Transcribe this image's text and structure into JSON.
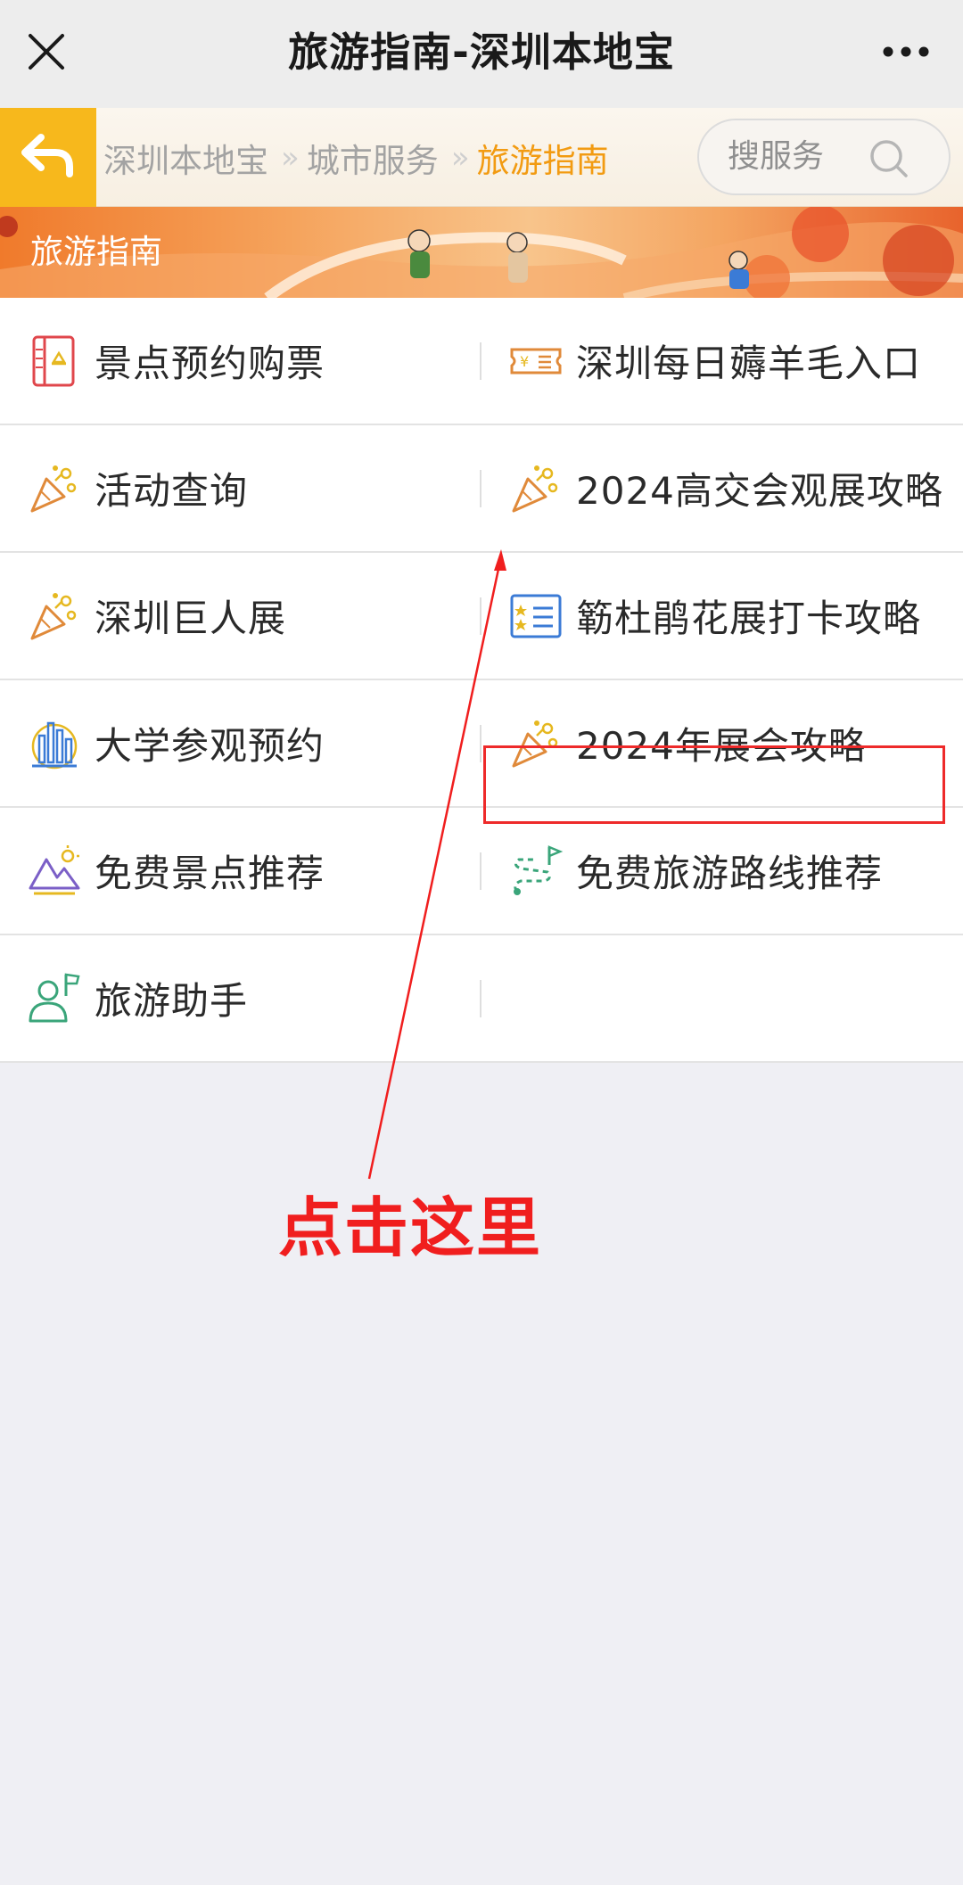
{
  "topbar": {
    "title": "旅游指南-深圳本地宝",
    "close_icon": "close-icon",
    "more_icon": "more-dots-icon"
  },
  "breadcrumb": {
    "back_icon": "back-arrow-icon",
    "items": [
      "深圳本地宝",
      "城市服务",
      "旅游指南"
    ],
    "separator": "»",
    "active_color": "#f29b12"
  },
  "search": {
    "placeholder": "搜服务",
    "icon": "search-icon"
  },
  "banner": {
    "title": "旅游指南"
  },
  "grid": {
    "rows": [
      [
        {
          "label": "景点预约购票",
          "icon": "ticket-book-icon"
        },
        {
          "label": "深圳每日薅羊毛入口",
          "icon": "coupon-icon"
        }
      ],
      [
        {
          "label": "活动查询",
          "icon": "party-popper-icon"
        },
        {
          "label": "2024高交会观展攻略",
          "icon": "party-popper-icon"
        }
      ],
      [
        {
          "label": "深圳巨人展",
          "icon": "party-popper-icon"
        },
        {
          "label": "簕杜鹃花展打卡攻略",
          "icon": "checklist-icon"
        }
      ],
      [
        {
          "label": "大学参观预约",
          "icon": "university-icon"
        },
        {
          "label": "2024年展会攻略",
          "icon": "party-popper-icon"
        }
      ],
      [
        {
          "label": "免费景点推荐",
          "icon": "mountain-icon"
        },
        {
          "label": "免费旅游路线推荐",
          "icon": "route-flag-icon"
        }
      ],
      [
        {
          "label": "旅游助手",
          "icon": "guide-person-icon"
        },
        {
          "label": "",
          "icon": ""
        }
      ]
    ]
  },
  "annotation": {
    "text": "点击这里",
    "color": "#f01e1e"
  }
}
